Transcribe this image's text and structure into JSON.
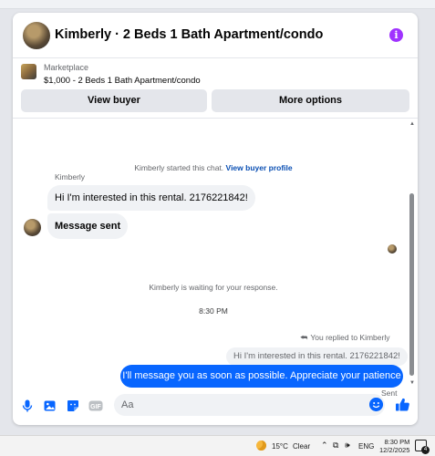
{
  "header": {
    "title": "Kimberly · 2 Beds 1 Bath Apartment/condo",
    "info_icon": "info-icon"
  },
  "marketplace": {
    "label": "Marketplace",
    "listing": "$1,000 - 2 Beds 1 Bath Apartment/condo",
    "view_buyer": "View buyer",
    "more_options": "More options"
  },
  "thread": {
    "started_text": "Kimberly started this chat.",
    "view_profile": "View buyer profile",
    "sender_name": "Kimberly",
    "incoming": [
      "Hi I'm interested in this rental. 2176221842!",
      "Message sent"
    ],
    "waiting_text": "Kimberly is waiting for your response.",
    "time_stamp": "8:30 PM",
    "replied_label": "You replied to Kimberly",
    "quoted_text": "Hi I'm interested in this rental. 2176221842!",
    "outgoing": "I'll message you as soon as possible. Appreciate your patience",
    "sent_status": "Sent"
  },
  "composer": {
    "placeholder": "Aa",
    "value": "",
    "icons": [
      "mic-icon",
      "gallery-icon",
      "sticker-icon",
      "gif-icon",
      "emoji-icon",
      "thumbs-up-icon"
    ],
    "gif_label": "GIF"
  },
  "taskbar": {
    "temperature": "15°C",
    "condition": "Clear",
    "language": "ENG",
    "time": "8:30 PM",
    "date": "12/2/2025",
    "notification_count": "4"
  },
  "colors": {
    "accent": "#0866ff",
    "info_purple": "#a033ff",
    "link": "#0a4fb3"
  }
}
